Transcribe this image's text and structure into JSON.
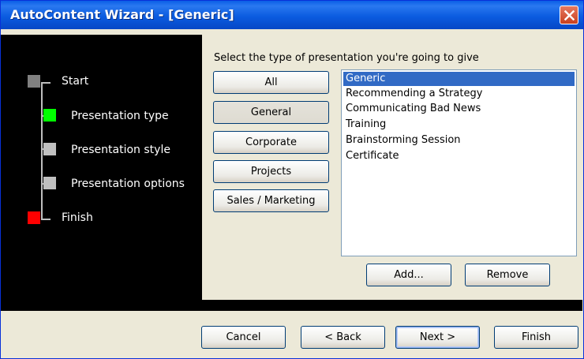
{
  "window": {
    "title": "AutoContent Wizard - [Generic]"
  },
  "steps": [
    {
      "label": "Start",
      "color": "#808080"
    },
    {
      "label": "Presentation type",
      "color": "#00ff00"
    },
    {
      "label": "Presentation style",
      "color": "#c0c0c0"
    },
    {
      "label": "Presentation options",
      "color": "#c0c0c0"
    },
    {
      "label": "Finish",
      "color": "#ff0000"
    }
  ],
  "main": {
    "prompt": "Select the type of presentation you're going to give",
    "categories": [
      "All",
      "General",
      "Corporate",
      "Projects",
      "Sales / Marketing"
    ],
    "selected_category": "General",
    "presentations": [
      "Generic",
      "Recommending a Strategy",
      "Communicating Bad News",
      "Training",
      "Brainstorming Session",
      "Certificate"
    ],
    "selected_presentation": "Generic",
    "add_label": "Add...",
    "remove_label": "Remove"
  },
  "footer": {
    "cancel_label": "Cancel",
    "back_label": "< Back",
    "next_label": "Next >",
    "finish_label": "Finish"
  }
}
